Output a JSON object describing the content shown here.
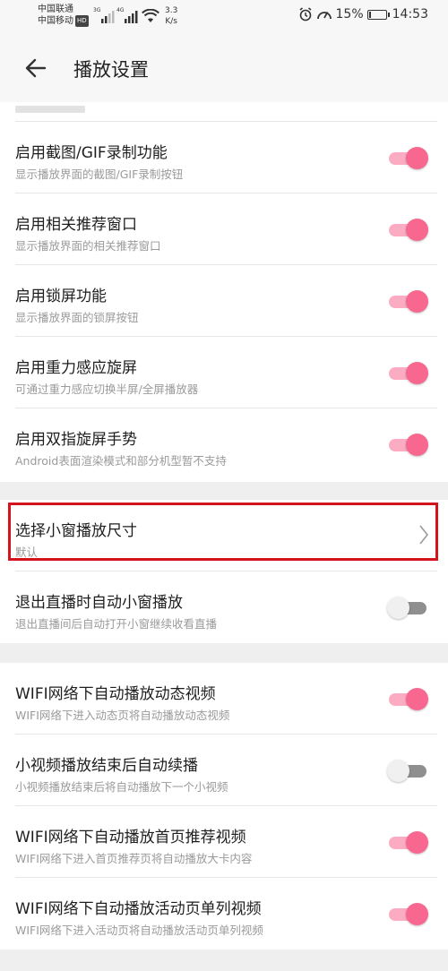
{
  "status_bar": {
    "carrier1": "中国联通",
    "carrier2": "中国移动",
    "hd_badge": "HD",
    "sig1_tag": "3G",
    "sig2_tag": "4G",
    "speed_value": "3.3",
    "speed_unit": "K/s",
    "battery": "15%",
    "battery_level": 0.15,
    "time": "14:53"
  },
  "header": {
    "title": "播放设置"
  },
  "colors": {
    "accent": "#f8678f",
    "off_knob": "#f0f0f0",
    "off_track": "#8f8f8f"
  },
  "settings": [
    {
      "title": "启用截图/GIF录制功能",
      "subtitle": "显示播放界面的截图/GIF录制按钮",
      "on": true
    },
    {
      "title": "启用相关推荐窗口",
      "subtitle": "显示播放界面的相关推荐窗口",
      "on": true
    },
    {
      "title": "启用锁屏功能",
      "subtitle": "显示播放界面的锁屏按钮",
      "on": true
    },
    {
      "title": "启用重力感应旋屏",
      "subtitle": "可通过重力感应切换半屏/全屏播放器",
      "on": true
    },
    {
      "title": "启用双指旋屏手势",
      "subtitle": "Android表面渲染模式和部分机型暂不支持",
      "on": true
    }
  ],
  "window_size": {
    "title": "选择小窗播放尺寸",
    "value": "默认"
  },
  "exit_live": {
    "title": "退出直播时自动小窗播放",
    "subtitle": "退出直播间后自动打开小窗继续收看直播",
    "on": false
  },
  "video_settings": [
    {
      "title": "WIFI网络下自动播放动态视频",
      "subtitle": "WIFI网络下进入动态页将自动播放动态视频",
      "on": true
    },
    {
      "title": "小视频播放结束后自动续播",
      "subtitle": "小视频播放结束后将自动播放下一个小视频",
      "on": false
    },
    {
      "title": "WIFI网络下自动播放首页推荐视频",
      "subtitle": "WIFI网络下进入首页推荐页将自动播放大卡内容",
      "on": true
    },
    {
      "title": "WIFI网络下自动播放活动页单列视频",
      "subtitle": "WIFI网络下进入活动页将自动播放活动页单列视频",
      "on": true
    }
  ]
}
